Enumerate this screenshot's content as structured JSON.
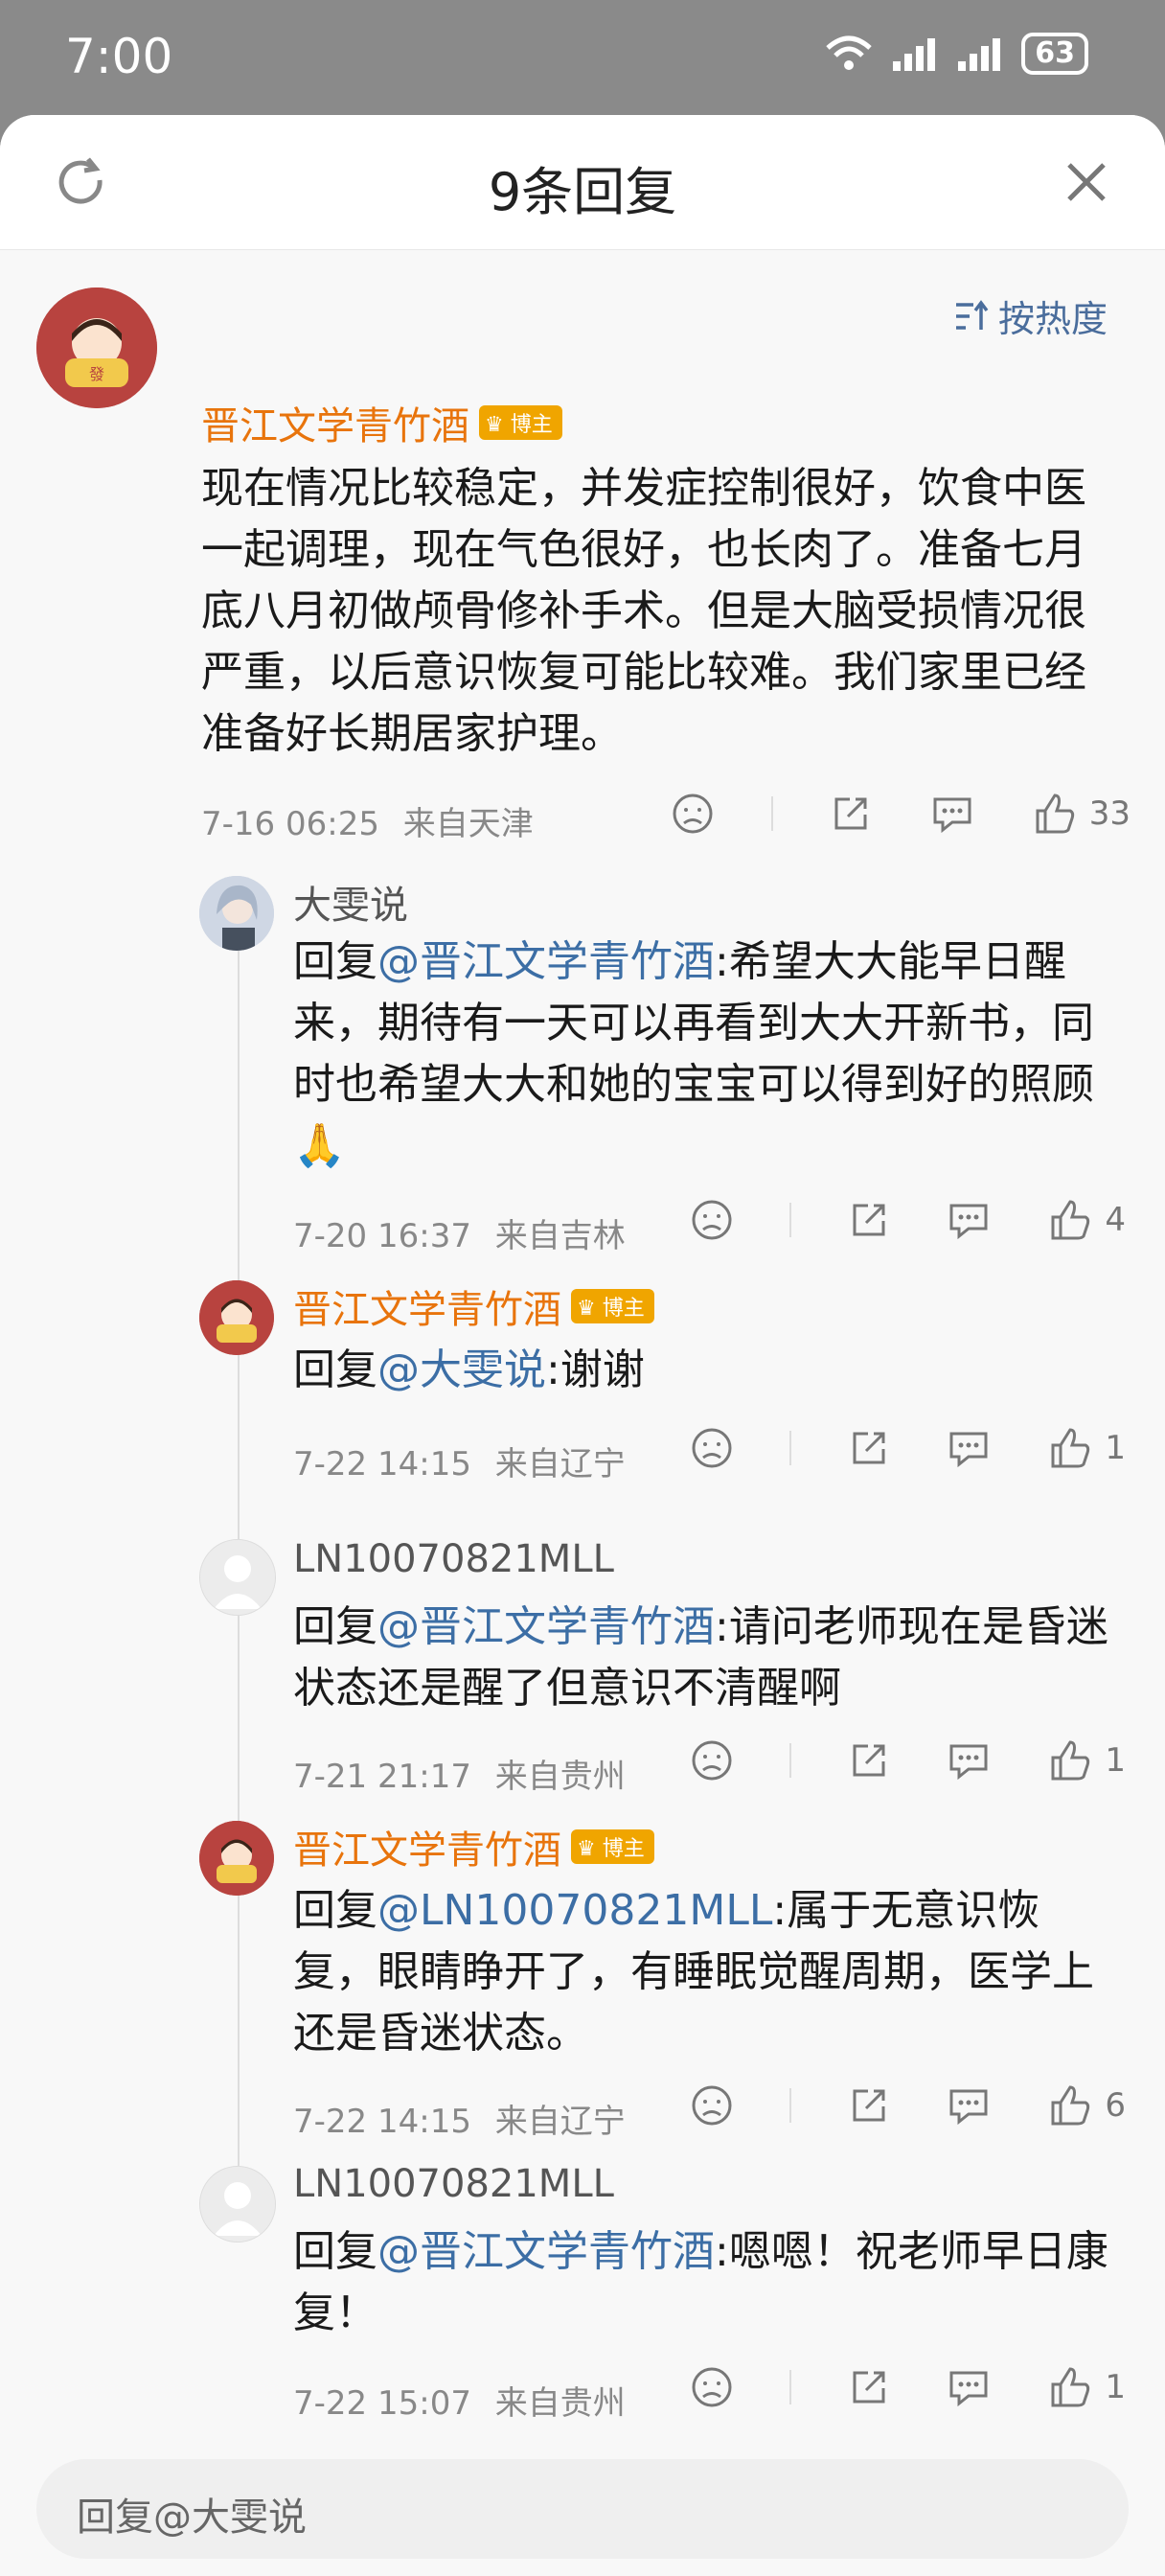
{
  "status": {
    "time": "7:00",
    "battery": "63"
  },
  "header": {
    "title": "9条回复",
    "sort_label": "按热度"
  },
  "colors": {
    "name_orange": "#e8740c",
    "mention_blue": "#3c6ea5",
    "badge_gold": "#f0a500"
  },
  "main_comment": {
    "author": "晋江文学青竹酒",
    "badge": "博主",
    "text": "现在情况比较稳定，并发症控制很好，饮食中医一起调理，现在气色很好，也长肉了。准备七月底八月初做颅骨修补手术。但是大脑受损情况很严重，以后意识恢复可能比较难。我们家里已经准备好长期居家护理。",
    "time": "7-16 06:25",
    "location": "来自天津",
    "likes": "33"
  },
  "replies": [
    {
      "author": "大雯说",
      "badge": "",
      "prefix": "回复",
      "mention": "@晋江文学青竹酒",
      "text": ":希望大大能早日醒来，期待有一天可以再看到大大开新书，同时也希望大大和她的宝宝可以得到好的照顾🙏",
      "time": "7-20 16:37",
      "location": "来自吉林",
      "likes": "4"
    },
    {
      "author": "晋江文学青竹酒",
      "badge": "博主",
      "prefix": "回复",
      "mention": "@大雯说",
      "text": ":谢谢",
      "time": "7-22 14:15",
      "location": "来自辽宁",
      "likes": "1"
    },
    {
      "author": "LN10070821MLL",
      "badge": "",
      "prefix": "回复",
      "mention": "@晋江文学青竹酒",
      "text": ":请问老师现在是昏迷状态还是醒了但意识不清醒啊",
      "time": "7-21 21:17",
      "location": "来自贵州",
      "likes": "1"
    },
    {
      "author": "晋江文学青竹酒",
      "badge": "博主",
      "prefix": "回复",
      "mention": "@LN10070821MLL",
      "text": ":属于无意识恢复，眼睛睁开了，有睡眠觉醒周期，医学上还是昏迷状态。",
      "time": "7-22 14:15",
      "location": "来自辽宁",
      "likes": "6"
    },
    {
      "author": "LN10070821MLL",
      "badge": "",
      "prefix": "回复",
      "mention": "@晋江文学青竹酒",
      "text": ":嗯嗯！祝老师早日康复！",
      "time": "7-22 15:07",
      "location": "来自贵州",
      "likes": "1"
    }
  ],
  "reply_input": {
    "placeholder": "回复@大雯说"
  }
}
